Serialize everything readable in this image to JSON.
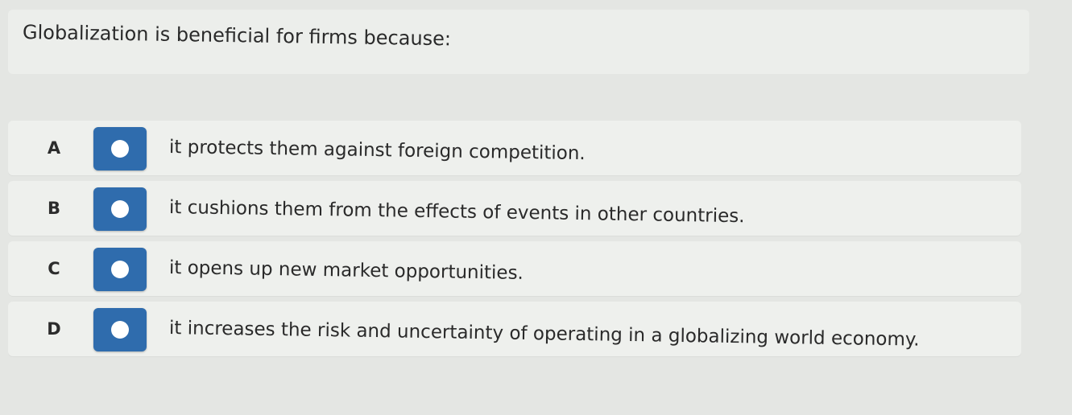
{
  "question": {
    "text": "Globalization is beneficial for firms because:"
  },
  "options": [
    {
      "letter": "A",
      "text": "it protects them against foreign competition."
    },
    {
      "letter": "B",
      "text": "it cushions them from the effects of events in other countries."
    },
    {
      "letter": "C",
      "text": "it opens up new market opportunities."
    },
    {
      "letter": "D",
      "text": "it increases the risk and uncertainty of operating in a globalizing world economy."
    }
  ],
  "colors": {
    "radio_box": "#2f6cad",
    "radio_dot": "#ffffff",
    "background": "#e4e6e3"
  }
}
